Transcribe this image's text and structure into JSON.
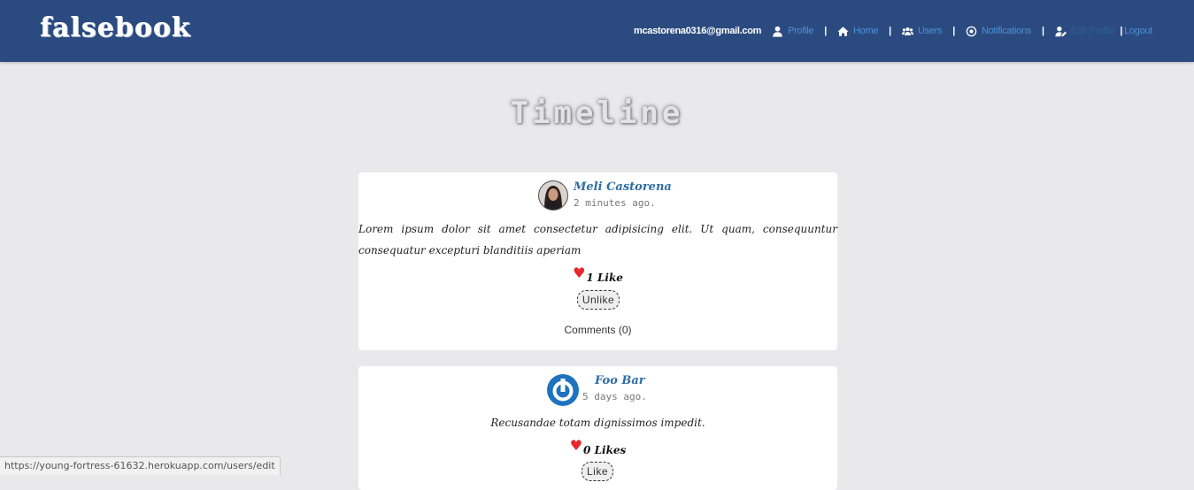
{
  "navbar": {
    "brand": "falsebook",
    "email": "mcastorena0316@gmail.com",
    "links": [
      {
        "label": "Profile",
        "icon": "user-icon"
      },
      {
        "label": "Home",
        "icon": "home-icon"
      },
      {
        "label": "Users",
        "icon": "users-icon"
      },
      {
        "label": "Notifications",
        "icon": "notifications-icon"
      },
      {
        "label": "Edit Profile",
        "icon": "user-edit-icon"
      },
      {
        "label": "Logout",
        "icon": ""
      }
    ],
    "separator": "|"
  },
  "page": {
    "title": "Timeline"
  },
  "posts": [
    {
      "author": "Meli Castorena",
      "time": "2 minutes ago.",
      "body": "Lorem ipsum dolor sit amet consectetur adipisicing elit. Ut quam, consequuntur consequatur excepturi blanditiis aperiam",
      "likes": "1 Like",
      "action": "Unlike",
      "comments": "Comments (0)"
    },
    {
      "author": "Foo Bar",
      "time": "5 days ago.",
      "body": "Recusandae totam dignissimos impedit.",
      "likes": "0 Likes",
      "action": "Like"
    }
  ],
  "status_bar": {
    "url": "https://young-fortress-61632.herokuapp.com/users/edit"
  },
  "colors": {
    "navbar": "#2b4b80",
    "link": "#4a90d6",
    "author": "#2e6da4",
    "heart": "#e8262c",
    "background": "#e9e9ec"
  }
}
